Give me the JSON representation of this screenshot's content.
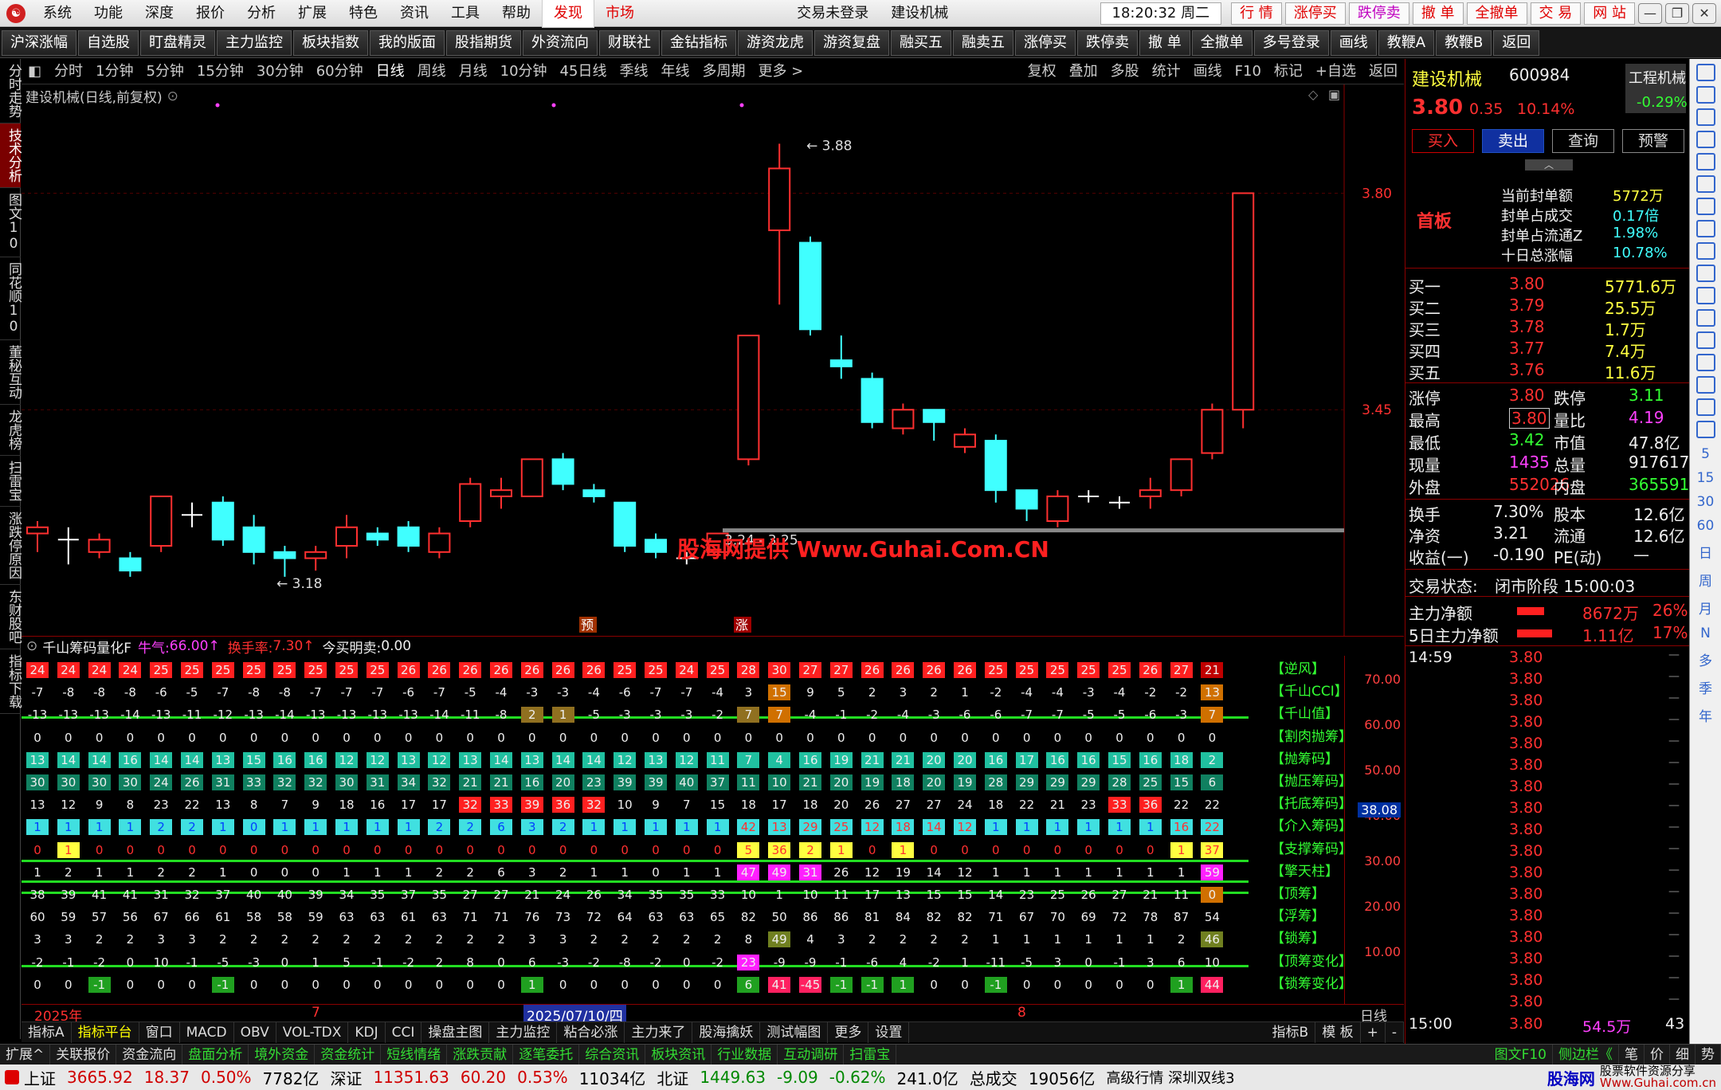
{
  "menubar": {
    "items": [
      "系统",
      "功能",
      "深度",
      "报价",
      "分析",
      "扩展",
      "特色",
      "资讯",
      "工具",
      "帮助"
    ],
    "discover": "发现",
    "market": "市场",
    "login_status": "交易未登录",
    "stock_title": "建设机械",
    "time": "18:20:32 周二",
    "trade_buttons": [
      "行 情",
      "涨停买",
      "跌停卖",
      "撤 单",
      "全撤单",
      "交 易",
      "网 站"
    ]
  },
  "toolbar": [
    "沪深涨幅",
    "自选股",
    "盯盘精灵",
    "主力监控",
    "板块指数",
    "我的版面",
    "股指期货",
    "外资流向",
    "财联社",
    "金钻指标",
    "游资龙虎",
    "游资复盘",
    "融买五",
    "融卖五",
    "涨停买",
    "跌停卖",
    "撤 单",
    "全撤单",
    "多号登录",
    "画线",
    "教鞭A",
    "教鞭B",
    "返回"
  ],
  "left_tabs": [
    "分时走势",
    "技术分析",
    "图文10",
    "同花顺10",
    "董秘互动",
    "龙虎榜",
    "扫雷宝",
    "涨跌停原因",
    "东财股吧",
    "指标下载"
  ],
  "left_tab_active": 1,
  "periods": [
    "分时",
    "1分钟",
    "5分钟",
    "15分钟",
    "30分钟",
    "60分钟",
    "日线",
    "周线",
    "月线",
    "10分钟",
    "45日线",
    "季线",
    "年线",
    "多周期",
    "更多 >"
  ],
  "period_active": 6,
  "chart_tools": [
    "复权",
    "叠加",
    "多股",
    "统计",
    "画线",
    "F10",
    "标记",
    "+自选",
    "返回"
  ],
  "chart": {
    "label": "建设机械(日线,前复权)",
    "high_label": "3.88",
    "low_label": "3.18",
    "range_label": "3.24 - 3.25",
    "price_ticks": [
      "3.80",
      "3.45"
    ],
    "marker_yu": "预",
    "marker_zhang": "涨",
    "watermark": "股海网提供 Www.Guhai.Com.CN"
  },
  "chart_data": {
    "type": "candlestick",
    "series": [
      {
        "o": 3.25,
        "c": 3.26,
        "h": 3.27,
        "l": 3.22
      },
      {
        "o": 3.24,
        "c": 3.24,
        "h": 3.26,
        "l": 3.2
      },
      {
        "o": 3.22,
        "c": 3.24,
        "h": 3.25,
        "l": 3.21
      },
      {
        "o": 3.21,
        "c": 3.19,
        "h": 3.22,
        "l": 3.18
      },
      {
        "o": 3.23,
        "c": 3.31,
        "h": 3.31,
        "l": 3.22
      },
      {
        "o": 3.28,
        "c": 3.28,
        "h": 3.3,
        "l": 3.26
      },
      {
        "o": 3.3,
        "c": 3.24,
        "h": 3.31,
        "l": 3.23
      },
      {
        "o": 3.26,
        "c": 3.22,
        "h": 3.28,
        "l": 3.2
      },
      {
        "o": 3.22,
        "c": 3.21,
        "h": 3.23,
        "l": 3.18
      },
      {
        "o": 3.21,
        "c": 3.22,
        "h": 3.23,
        "l": 3.19
      },
      {
        "o": 3.23,
        "c": 3.26,
        "h": 3.28,
        "l": 3.21
      },
      {
        "o": 3.25,
        "c": 3.24,
        "h": 3.26,
        "l": 3.23
      },
      {
        "o": 3.26,
        "c": 3.23,
        "h": 3.27,
        "l": 3.22
      },
      {
        "o": 3.22,
        "c": 3.25,
        "h": 3.26,
        "l": 3.21
      },
      {
        "o": 3.27,
        "c": 3.33,
        "h": 3.34,
        "l": 3.26
      },
      {
        "o": 3.31,
        "c": 3.32,
        "h": 3.34,
        "l": 3.29
      },
      {
        "o": 3.31,
        "c": 3.37,
        "h": 3.37,
        "l": 3.31
      },
      {
        "o": 3.37,
        "c": 3.33,
        "h": 3.38,
        "l": 3.32
      },
      {
        "o": 3.32,
        "c": 3.31,
        "h": 3.33,
        "l": 3.3
      },
      {
        "o": 3.3,
        "c": 3.23,
        "h": 3.3,
        "l": 3.22
      },
      {
        "o": 3.24,
        "c": 3.22,
        "h": 3.25,
        "l": 3.21
      },
      {
        "o": 3.21,
        "c": 3.21,
        "h": 3.22,
        "l": 3.2
      },
      {
        "o": 3.22,
        "c": 3.25,
        "h": 3.25,
        "l": 3.22
      },
      {
        "o": 3.37,
        "c": 3.57,
        "h": 3.57,
        "l": 3.36
      },
      {
        "o": 3.74,
        "c": 3.84,
        "h": 3.88,
        "l": 3.62
      },
      {
        "o": 3.72,
        "c": 3.58,
        "h": 3.73,
        "l": 3.57
      },
      {
        "o": 3.53,
        "c": 3.52,
        "h": 3.57,
        "l": 3.5
      },
      {
        "o": 3.5,
        "c": 3.43,
        "h": 3.51,
        "l": 3.42
      },
      {
        "o": 3.42,
        "c": 3.45,
        "h": 3.46,
        "l": 3.41
      },
      {
        "o": 3.45,
        "c": 3.43,
        "h": 3.45,
        "l": 3.4
      },
      {
        "o": 3.39,
        "c": 3.41,
        "h": 3.42,
        "l": 3.38
      },
      {
        "o": 3.4,
        "c": 3.32,
        "h": 3.41,
        "l": 3.3
      },
      {
        "o": 3.32,
        "c": 3.29,
        "h": 3.32,
        "l": 3.27
      },
      {
        "o": 3.27,
        "c": 3.31,
        "h": 3.32,
        "l": 3.26
      },
      {
        "o": 3.31,
        "c": 3.31,
        "h": 3.32,
        "l": 3.3
      },
      {
        "o": 3.3,
        "c": 3.3,
        "h": 3.31,
        "l": 3.29
      },
      {
        "o": 3.31,
        "c": 3.32,
        "h": 3.34,
        "l": 3.29
      },
      {
        "o": 3.32,
        "c": 3.37,
        "h": 3.37,
        "l": 3.31
      },
      {
        "o": 3.38,
        "c": 3.45,
        "h": 3.46,
        "l": 3.37
      },
      {
        "o": 3.45,
        "c": 3.8,
        "h": 3.8,
        "l": 3.42
      }
    ],
    "up_color": "#ff3030",
    "down_color": "#40ffff",
    "ylim": [
      3.1,
      3.95
    ]
  },
  "indicator": {
    "name": "千山筹码量化F",
    "niuqi_label": "牛气:",
    "niuqi_val": "66.00",
    "huoshou_label": "换手率:",
    "huoshou_val": "7.30",
    "jin_label": "今买明卖:",
    "jin_val": "0.00",
    "scale": [
      "70.00",
      "60.00",
      "50.00",
      "40.00",
      "30.00",
      "20.00",
      "10.00"
    ],
    "current_tag": "38.08",
    "labels": [
      "【逆风】",
      "【千山CCI】",
      "【千山值】",
      "【割肉抛筹】",
      "【抛筹码】",
      "【抛压筹码】",
      "【托底筹码】",
      "【介入筹码】",
      "【支撑筹码】",
      "【擎天柱】",
      "【顶筹】",
      "【浮筹】",
      "【锁筹】",
      "【顶筹变化】",
      "【锁筹变化】"
    ],
    "rows": [
      [
        "24",
        "24",
        "24",
        "24",
        "25",
        "25",
        "25",
        "25",
        "25",
        "25",
        "25",
        "25",
        "26",
        "26",
        "26",
        "26",
        "26",
        "26",
        "26",
        "25",
        "25",
        "24",
        "25",
        "28",
        "30",
        "27",
        "27",
        "26",
        "26",
        "26",
        "26",
        "25",
        "25",
        "25",
        "25",
        "25",
        "26",
        "27",
        "21"
      ],
      [
        "-7",
        "-8",
        "-8",
        "-8",
        "-6",
        "-5",
        "-7",
        "-8",
        "-8",
        "-7",
        "-7",
        "-7",
        "-6",
        "-7",
        "-5",
        "-4",
        "-3",
        "-3",
        "-4",
        "-6",
        "-7",
        "-7",
        "-4",
        "3",
        "15",
        "9",
        "5",
        "2",
        "3",
        "2",
        "1",
        "-2",
        "-4",
        "-4",
        "-3",
        "-4",
        "-2",
        "-2",
        "13"
      ],
      [
        "-13",
        "-13",
        "-13",
        "-14",
        "-13",
        "-11",
        "-12",
        "-13",
        "-14",
        "-13",
        "-13",
        "-13",
        "-13",
        "-14",
        "-11",
        "-8",
        "2",
        "1",
        "-5",
        "-3",
        "-3",
        "-3",
        "-2",
        "7",
        "7",
        "-4",
        "-1",
        "-2",
        "-4",
        "-3",
        "-6",
        "-6",
        "-7",
        "-7",
        "-5",
        "-5",
        "-6",
        "-3",
        "7"
      ],
      [
        "0",
        "0",
        "0",
        "0",
        "0",
        "0",
        "0",
        "0",
        "0",
        "0",
        "0",
        "0",
        "0",
        "0",
        "0",
        "0",
        "0",
        "0",
        "0",
        "0",
        "0",
        "0",
        "0",
        "0",
        "0",
        "0",
        "0",
        "0",
        "0",
        "0",
        "0",
        "0",
        "0",
        "0",
        "0",
        "0",
        "0",
        "0",
        "0"
      ],
      [
        "13",
        "14",
        "14",
        "16",
        "14",
        "14",
        "13",
        "15",
        "16",
        "16",
        "12",
        "12",
        "13",
        "12",
        "13",
        "14",
        "13",
        "14",
        "14",
        "12",
        "13",
        "12",
        "11",
        "7",
        "4",
        "16",
        "19",
        "21",
        "21",
        "20",
        "20",
        "16",
        "17",
        "16",
        "16",
        "15",
        "16",
        "18",
        "2"
      ],
      [
        "30",
        "30",
        "30",
        "30",
        "24",
        "26",
        "31",
        "33",
        "32",
        "32",
        "30",
        "31",
        "34",
        "32",
        "21",
        "21",
        "16",
        "20",
        "23",
        "39",
        "39",
        "40",
        "37",
        "11",
        "10",
        "21",
        "20",
        "19",
        "18",
        "20",
        "19",
        "28",
        "29",
        "29",
        "29",
        "28",
        "25",
        "15",
        "6"
      ],
      [
        "13",
        "12",
        "9",
        "8",
        "23",
        "22",
        "13",
        "8",
        "7",
        "9",
        "18",
        "16",
        "17",
        "17",
        "32",
        "33",
        "39",
        "36",
        "32",
        "10",
        "9",
        "7",
        "15",
        "18",
        "17",
        "18",
        "20",
        "26",
        "27",
        "27",
        "24",
        "18",
        "22",
        "21",
        "23",
        "33",
        "36",
        "22",
        "22"
      ],
      [
        "1",
        "1",
        "1",
        "1",
        "2",
        "2",
        "1",
        "0",
        "1",
        "1",
        "1",
        "1",
        "1",
        "2",
        "2",
        "6",
        "3",
        "2",
        "1",
        "1",
        "1",
        "1",
        "1",
        "42",
        "13",
        "29",
        "25",
        "12",
        "18",
        "14",
        "12",
        "1",
        "1",
        "1",
        "1",
        "1",
        "1",
        "16",
        "22"
      ],
      [
        "0",
        "1",
        "0",
        "0",
        "0",
        "0",
        "0",
        "0",
        "0",
        "0",
        "0",
        "0",
        "0",
        "0",
        "0",
        "0",
        "0",
        "0",
        "0",
        "0",
        "0",
        "0",
        "0",
        "5",
        "36",
        "2",
        "1",
        "0",
        "1",
        "0",
        "0",
        "0",
        "0",
        "0",
        "0",
        "0",
        "0",
        "1",
        "37"
      ],
      [
        "1",
        "2",
        "1",
        "1",
        "2",
        "2",
        "1",
        "0",
        "0",
        "0",
        "1",
        "1",
        "1",
        "2",
        "2",
        "6",
        "3",
        "2",
        "1",
        "1",
        "0",
        "1",
        "1",
        "47",
        "49",
        "31",
        "26",
        "12",
        "19",
        "14",
        "12",
        "1",
        "1",
        "1",
        "1",
        "1",
        "1",
        "1",
        "59"
      ],
      [
        "38",
        "39",
        "41",
        "41",
        "31",
        "32",
        "37",
        "40",
        "40",
        "39",
        "34",
        "35",
        "37",
        "35",
        "27",
        "27",
        "21",
        "24",
        "26",
        "34",
        "35",
        "35",
        "33",
        "10",
        "1",
        "10",
        "11",
        "17",
        "13",
        "15",
        "15",
        "14",
        "23",
        "25",
        "26",
        "27",
        "21",
        "11",
        "0"
      ],
      [
        "60",
        "59",
        "57",
        "56",
        "67",
        "66",
        "61",
        "58",
        "58",
        "59",
        "63",
        "63",
        "61",
        "63",
        "71",
        "71",
        "76",
        "73",
        "72",
        "64",
        "63",
        "63",
        "65",
        "82",
        "50",
        "86",
        "86",
        "81",
        "84",
        "82",
        "82",
        "71",
        "67",
        "70",
        "69",
        "72",
        "78",
        "87",
        "54"
      ],
      [
        "3",
        "3",
        "2",
        "2",
        "3",
        "3",
        "2",
        "2",
        "2",
        "2",
        "2",
        "2",
        "2",
        "2",
        "2",
        "2",
        "3",
        "3",
        "2",
        "2",
        "2",
        "2",
        "2",
        "8",
        "49",
        "4",
        "3",
        "2",
        "2",
        "2",
        "2",
        "1",
        "1",
        "1",
        "1",
        "1",
        "1",
        "2",
        "46"
      ],
      [
        "-2",
        "-1",
        "-2",
        "0",
        "10",
        "-1",
        "-5",
        "-3",
        "0",
        "1",
        "5",
        "-1",
        "-2",
        "2",
        "8",
        "0",
        "6",
        "-3",
        "-2",
        "-8",
        "-2",
        "0",
        "-2",
        "23",
        "-9",
        "-9",
        "-1",
        "-6",
        "4",
        "-2",
        "1",
        "-11",
        "-5",
        "3",
        "0",
        "-1",
        "3",
        "6",
        "10"
      ],
      [
        "0",
        "0",
        "-1",
        "0",
        "0",
        "0",
        "-1",
        "0",
        "0",
        "0",
        "0",
        "0",
        "0",
        "0",
        "0",
        "0",
        "1",
        "0",
        "0",
        "0",
        "0",
        "0",
        "0",
        "6",
        "41",
        "-45",
        "-1",
        "-1",
        "1",
        "0",
        "0",
        "-1",
        "0",
        "0",
        "0",
        "0",
        "0",
        "1",
        "44"
      ]
    ]
  },
  "date_axis": {
    "year": "2025年",
    "m1": "7",
    "sel": "2025/07/10/四",
    "m2": "8",
    "period": "日线"
  },
  "bottom_tabs": [
    "指标A",
    "指标平台",
    "窗口",
    "MACD",
    "OBV",
    "VOL-TDX",
    "KDJ",
    "CCI",
    "操盘主图",
    "主力监控",
    "粘合必涨",
    "主力来了",
    "股海擒妖",
    "测试幅图",
    "更多",
    "设置"
  ],
  "bottom_tabs_right": [
    "指标B",
    "模 板",
    "+",
    "-"
  ],
  "footer_links": [
    "扩展^",
    "关联报价",
    "资金流向",
    "盘面分析",
    "境外资金",
    "资金统计",
    "短线情绪",
    "涨跌贡献",
    "逐笔委托",
    "综合资讯",
    "板块资讯",
    "行业数据",
    "互动调研",
    "扫雷宝"
  ],
  "footer_links_right": [
    "图文F10",
    "侧边栏《",
    "笔",
    "价",
    "细",
    "势"
  ],
  "status": {
    "sh_label": "上证",
    "sh_val": "3665.92",
    "sh_chg": "18.37",
    "sh_pct": "0.50%",
    "sh_amt": "7782亿",
    "sz_label": "深证",
    "sz_val": "11351.63",
    "sz_chg": "60.20",
    "sz_pct": "0.53%",
    "sz_amt": "11034亿",
    "bj_label": "北证",
    "bj_val": "1449.63",
    "bj_chg": "-9.09",
    "bj_pct": "-0.62%",
    "bj_amt": "241.0亿",
    "total_label": "总成交",
    "total_val": "19056亿",
    "tag": "高级行情 深圳双线3",
    "brand": "股海网",
    "brand2": "股票软件资源分享",
    "brand_url": "Www.Guhai.com.cn"
  },
  "quote": {
    "name": "建设机械",
    "code": "600984",
    "sector": "工程机械",
    "sector_pct": "-0.29%",
    "price": "3.80",
    "chg": "0.35",
    "pct": "10.14%",
    "actions": [
      "买入",
      "卖出",
      "查询",
      "预警"
    ],
    "board": "首板",
    "seal": [
      [
        "当前封单额",
        "5772万"
      ],
      [
        "封单占成交",
        "0.17倍"
      ],
      [
        "封单占流通Z",
        "1.98%"
      ],
      [
        "十日总涨幅",
        "10.78%"
      ]
    ],
    "bids": [
      [
        "买一",
        "3.80",
        "5771.6万"
      ],
      [
        "买二",
        "3.79",
        "25.5万"
      ],
      [
        "买三",
        "3.78",
        "1.7万"
      ],
      [
        "买四",
        "3.77",
        "7.4万"
      ],
      [
        "买五",
        "3.76",
        "11.6万"
      ]
    ],
    "stats": [
      [
        "涨停",
        "3.80",
        "跌停",
        "3.11"
      ],
      [
        "最高",
        "3.80",
        "量比",
        "4.19"
      ],
      [
        "最低",
        "3.42",
        "市值",
        "47.8亿"
      ],
      [
        "现量",
        "1435",
        "总量",
        "917617"
      ],
      [
        "外盘",
        "552026",
        "内盘",
        "365591"
      ]
    ],
    "stats2": [
      [
        "换手",
        "7.30%",
        "股本",
        "12.6亿"
      ],
      [
        "净资",
        "3.21",
        "流通",
        "12.6亿"
      ],
      [
        "收益(一)",
        "-0.190",
        "PE(动)",
        "—"
      ]
    ],
    "state_label": "交易状态:",
    "state": "闭市阶段 15:00:03",
    "flow": [
      [
        "主力净额",
        "8672万",
        "26%"
      ],
      [
        "5日主力净额",
        "1.11亿",
        "17%"
      ]
    ],
    "ticks_time_start": "14:59",
    "tick_price": "3.80",
    "ticks_time_end": "15:00",
    "last_vol": "54.5万",
    "last_n": "43"
  },
  "right_tools": [
    "5",
    "15",
    "30",
    "60",
    "日",
    "周",
    "月",
    "N",
    "多",
    "季",
    "年"
  ]
}
